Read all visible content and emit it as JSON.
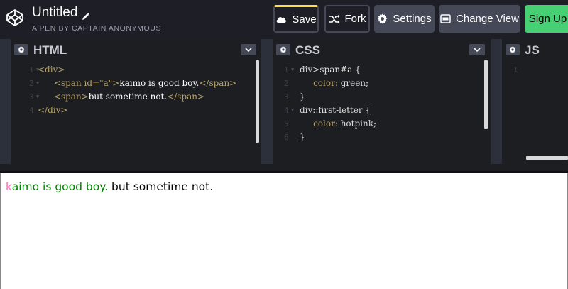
{
  "header": {
    "title": "Untitled",
    "subtitle": "A PEN BY CAPTAIN ANONYMOUS",
    "buttons": {
      "save": "Save",
      "fork": "Fork",
      "settings": "Settings",
      "change_view": "Change View",
      "signup": "Sign Up"
    }
  },
  "panes": {
    "html": {
      "title": "HTML",
      "line_numbers": [
        "1",
        "2",
        "3",
        "4"
      ],
      "code": {
        "l1_open": "<div>",
        "l2_open_a": "<span ",
        "l2_attr": "id=",
        "l2_str": "\"a\"",
        "l2_close_a": ">",
        "l2_text": "kaimo is good boy.",
        "l2_close": "</span>",
        "l3_open": "<span>",
        "l3_text": "but sometime not.",
        "l3_close": "</span>",
        "l4_close": "</div>"
      }
    },
    "css": {
      "title": "CSS",
      "line_numbers": [
        "1",
        "2",
        "3",
        "4",
        "5",
        "6"
      ],
      "code": {
        "l1": "div>span#a {",
        "l2_prop": "color: ",
        "l2_val": "green;",
        "l3": "}",
        "l4_sel": "div::first-letter ",
        "l4_brace": "{",
        "l5_prop": "color: ",
        "l5_val": "hotpink;",
        "l6": "}"
      }
    },
    "js": {
      "title": "JS",
      "line_numbers": [
        "1"
      ]
    }
  },
  "preview": {
    "first_letter": "k",
    "span_rest": "aimo is good boy.",
    "plain": " but sometime not.",
    "colors": {
      "first_letter": "#ff69b4",
      "span": "#008000",
      "text": "#000000"
    }
  },
  "colors": {
    "header_bg": "#1e1f26",
    "button_bg": "#444857",
    "save_accent": "#ffdd40",
    "signup_bg": "#47cf73",
    "editor_bg": "#1d1e22"
  }
}
